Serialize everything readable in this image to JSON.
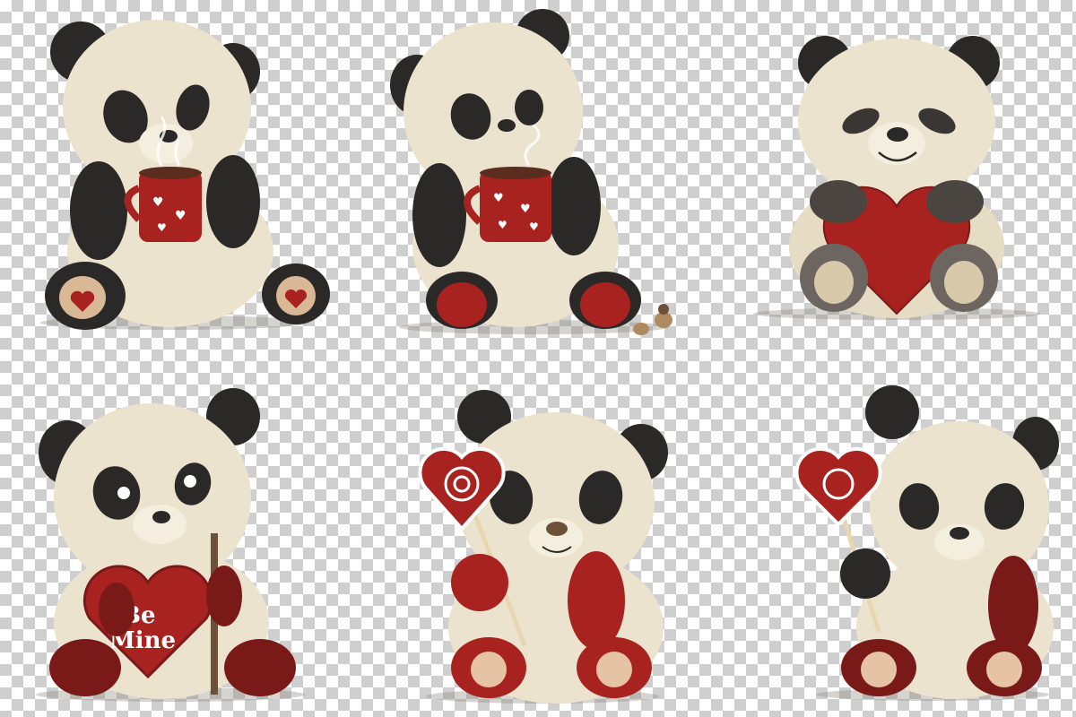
{
  "colors": {
    "fur_cream": "#ece3cf",
    "fur_shadow": "#cdbf9f",
    "fur_black": "#2b2927",
    "accent_red": "#a8221f",
    "dark_red": "#7a1a18",
    "checker_light": "#ffffff",
    "checker_dark": "#cfcfcf"
  },
  "pandas": [
    {
      "pose": "holding steaming mug with hearts",
      "props": [
        "red mug",
        "steam"
      ]
    },
    {
      "pose": "sipping mug, eyes closed",
      "props": [
        "red mug",
        "birds"
      ]
    },
    {
      "pose": "hugging red heart",
      "props": [
        "red heart"
      ]
    },
    {
      "pose": "holding heart sign",
      "props": [
        "heart sign",
        "stick"
      ]
    },
    {
      "pose": "holding heart lollipop",
      "props": [
        "swirl lollipop"
      ]
    },
    {
      "pose": "holding heart lollipop, seated",
      "props": [
        "swirl lollipop"
      ]
    }
  ],
  "sign": {
    "line1": "Be",
    "line2": "Mine"
  }
}
